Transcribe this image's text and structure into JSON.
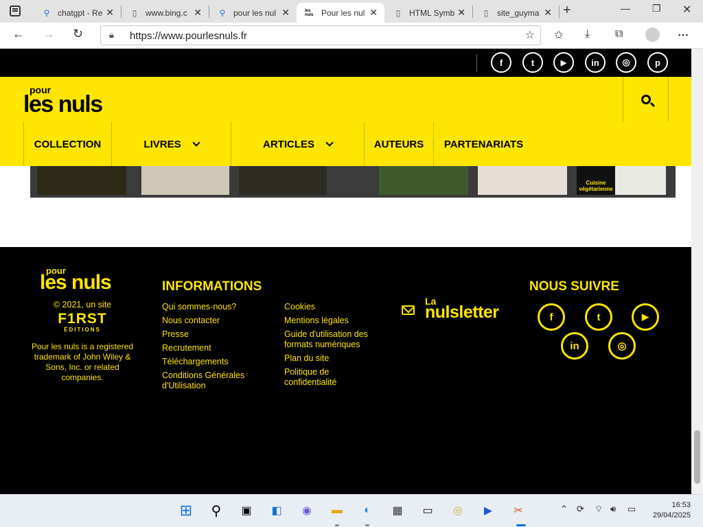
{
  "browser": {
    "tabs": [
      {
        "title": "chatgpt - Re",
        "icon": "search-icon"
      },
      {
        "title": "www.bing.c",
        "icon": "page-icon"
      },
      {
        "title": "pour les nul",
        "icon": "search-icon"
      },
      {
        "title": "Pour les nul",
        "icon": "pourlesnuls-favicon",
        "favicon_text": "les nuls",
        "active": true
      },
      {
        "title": "HTML Symb",
        "icon": "page-icon"
      },
      {
        "title": "site_guyma",
        "icon": "page-icon"
      }
    ],
    "url": "https://www.pourlesnuls.fr"
  },
  "site": {
    "logo_pour": "pour",
    "logo_nuls": "les nuls",
    "nav": [
      {
        "label": "COLLECTION",
        "dropdown": false
      },
      {
        "label": "LIVRES",
        "dropdown": true
      },
      {
        "label": "ARTICLES",
        "dropdown": true
      },
      {
        "label": "AUTEURS",
        "dropdown": false
      },
      {
        "label": "PARTENARIATS",
        "dropdown": false
      }
    ],
    "top_social": [
      "f",
      "t",
      "▶",
      "in",
      "◎",
      "p"
    ],
    "strip_caption": "Cuisine végétarienne"
  },
  "footer": {
    "logo_pour": "pour",
    "logo_nuls": "les nuls",
    "copyright": "© 2021, un site",
    "first": "F1RST",
    "editions": "ÉDITIONS",
    "trademark": "Pour les nuls is a registered trademark of John Wiley & Sons, Inc. or related companies.",
    "info_title": "INFORMATIONS",
    "links_col1": [
      "Qui sommes-nous?",
      "Nous contacter",
      "Presse",
      "Recrutement",
      "Téléchargements",
      "Conditions Générales d'Utilisation"
    ],
    "links_col2": [
      "Cookies",
      "Mentions légales",
      "Guide d'utilisation des formats numériques",
      "Plan du site",
      "Politique de confidentialité"
    ],
    "newsletter_la": "La",
    "newsletter_name": "nulsletter",
    "follow_title": "NOUS SUIVRE",
    "social": [
      "f",
      "t",
      "▶",
      "in",
      "◎"
    ]
  },
  "taskbar": {
    "time": "16:53",
    "date": "29/04/2025"
  },
  "colors": {
    "brand_yellow": "#ffe600",
    "black": "#000000"
  }
}
